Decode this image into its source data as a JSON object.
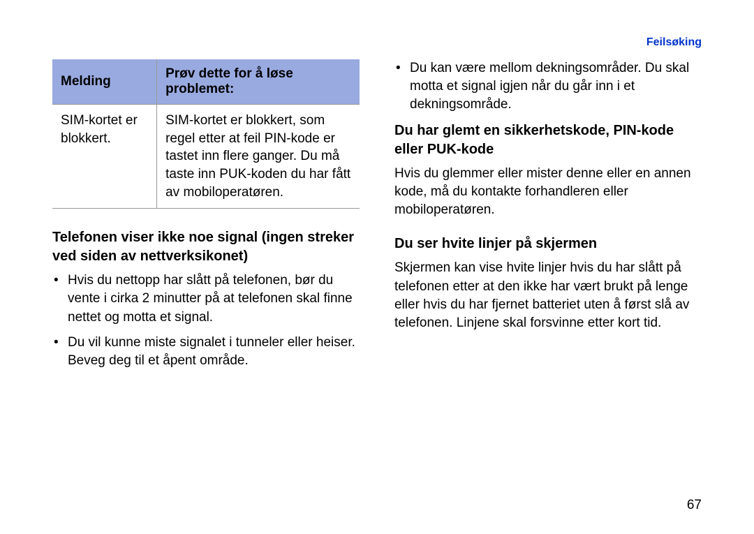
{
  "header": {
    "label": "Feilsøking"
  },
  "left": {
    "table": {
      "head_a": "Melding",
      "head_b": "Prøv dette for å løse problemet:",
      "row_a": "SIM-kortet er blokkert.",
      "row_b": "SIM-kortet er blokkert, som regel etter at feil PIN-kode er tastet inn flere ganger. Du må taste inn PUK-koden du har fått av mobiloperatøren."
    },
    "heading1": "Telefonen viser ikke noe signal (ingen streker ved siden av nettverksikonet)",
    "bullets": {
      "b1": "Hvis du nettopp har slått på telefonen, bør du vente i cirka 2 minutter på at telefonen skal finne nettet og motta et signal.",
      "b2": "Du vil kunne miste signalet i tunneler eller heiser. Beveg deg til et åpent område."
    }
  },
  "right": {
    "bullets": {
      "b1": "Du kan være mellom dekningsområder. Du skal motta et signal igjen når du går inn i et dekningsområde."
    },
    "heading1": "Du har glemt en sikkerhetskode, PIN-kode eller PUK-kode",
    "para1": "Hvis du glemmer eller mister denne eller en annen kode, må du kontakte forhandleren eller mobiloperatøren.",
    "heading2": "Du ser hvite linjer på skjermen",
    "para2": "Skjermen kan vise hvite linjer hvis du har slått på telefonen etter at den ikke har vært brukt på lenge eller hvis du har fjernet batteriet uten å først slå av telefonen. Linjene skal forsvinne etter kort tid."
  },
  "page_number": "67"
}
